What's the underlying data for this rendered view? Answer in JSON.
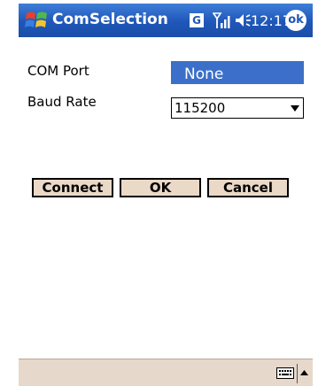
{
  "titlebar": {
    "app_title": "ComSelection",
    "status_g": "G",
    "clock": "12:17",
    "ok_label": "ok",
    "icons": [
      "windows-start-icon",
      "signal-icon",
      "volume-icon"
    ]
  },
  "form": {
    "com_port_label": "COM Port",
    "com_port_value": "None",
    "baud_rate_label": "Baud Rate",
    "baud_rate_value": "115200"
  },
  "buttons": {
    "connect": "Connect",
    "ok": "OK",
    "cancel": "Cancel"
  },
  "menubar": {
    "icons": [
      "keyboard-icon",
      "sip-up-arrow-icon"
    ]
  },
  "colors": {
    "titlebar": "#1f56b8",
    "selection": "#3b6fc9",
    "button_face": "#ead9c7",
    "menubar": "#e6d8cb"
  }
}
